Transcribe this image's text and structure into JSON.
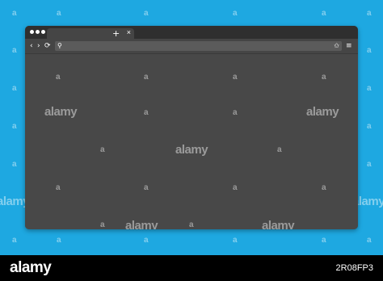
{
  "background": {
    "color": "#1ea8e1"
  },
  "browser": {
    "frame_color": "#484848",
    "titlebar_color": "#2f2f2f",
    "window_dots": 3,
    "tab": {
      "title": "",
      "close_glyph": "×"
    },
    "new_tab_glyph": "+",
    "toolbar": {
      "back_glyph": "‹",
      "forward_glyph": "›",
      "reload_glyph": "⟳",
      "url_value": "",
      "search_glyph": "⚲",
      "star_glyph": "✩",
      "menu_glyph": "≡"
    }
  },
  "watermark": {
    "text": "a",
    "brand": "alamy"
  },
  "footer": {
    "logo": "alamy",
    "image_id": "2R08FP3"
  }
}
